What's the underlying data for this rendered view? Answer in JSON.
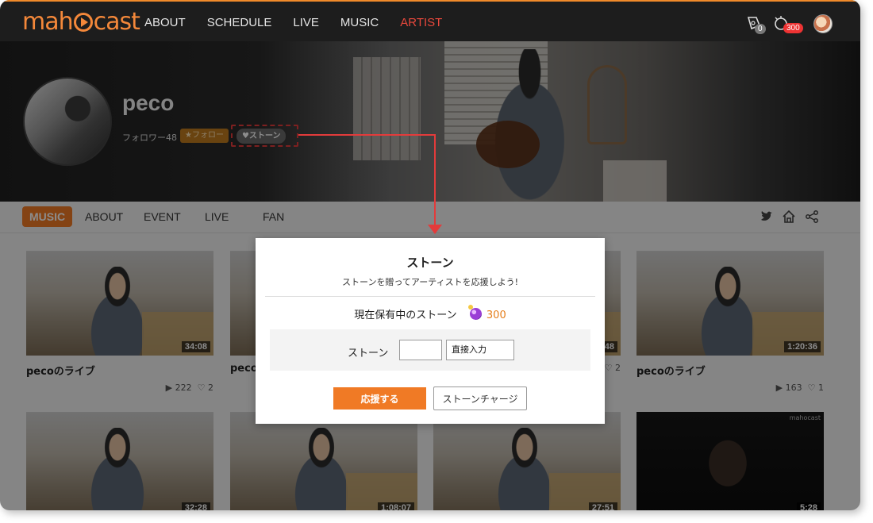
{
  "nav": {
    "logo": "mahocast",
    "links": [
      "ABOUT",
      "SCHEDULE",
      "LIVE",
      "MUSIC",
      "ARTIST"
    ],
    "active_link": "ARTIST",
    "ticket_count": "0",
    "stone_count": "300"
  },
  "artist": {
    "name": "peco",
    "followers": "フォロワー48",
    "follow_label": "★フォロー",
    "stone_label": "♥ストーン"
  },
  "subnav": {
    "tabs": [
      "MUSIC",
      "ABOUT",
      "EVENT",
      "LIVE",
      "FAN"
    ],
    "active": "MUSIC"
  },
  "videos": [
    {
      "title": "pecoのライブ",
      "duration": "34:08",
      "plays": "222",
      "likes": "2"
    },
    {
      "title": "peco",
      "duration": "",
      "plays": "",
      "likes": ""
    },
    {
      "title": "",
      "duration": "48",
      "plays": "",
      "likes": "2"
    },
    {
      "title": "pecoのライブ",
      "duration": "1:20:36",
      "plays": "163",
      "likes": "1"
    },
    {
      "title": "",
      "duration": "32:28",
      "plays": "",
      "likes": ""
    },
    {
      "title": "",
      "duration": "1:08:07",
      "plays": "",
      "likes": ""
    },
    {
      "title": "",
      "duration": "27:51",
      "plays": "",
      "likes": ""
    },
    {
      "title": "",
      "duration": "5:28",
      "plays": "",
      "likes": ""
    }
  ],
  "watermark": "mahocast",
  "modal": {
    "title": "ストーン",
    "subtitle": "ストーンを贈ってアーティストを応援しよう!",
    "holding_label": "現在保有中のストーン",
    "holding_count": "300",
    "entry_label": "ストーン",
    "entry_value": "",
    "select_value": "直接入力",
    "support_button": "応援する",
    "charge_button": "ストーンチャージ"
  },
  "colors": {
    "accent": "#f07a25",
    "highlight": "#e33b3b",
    "nav_bg": "#1d1d1d"
  }
}
